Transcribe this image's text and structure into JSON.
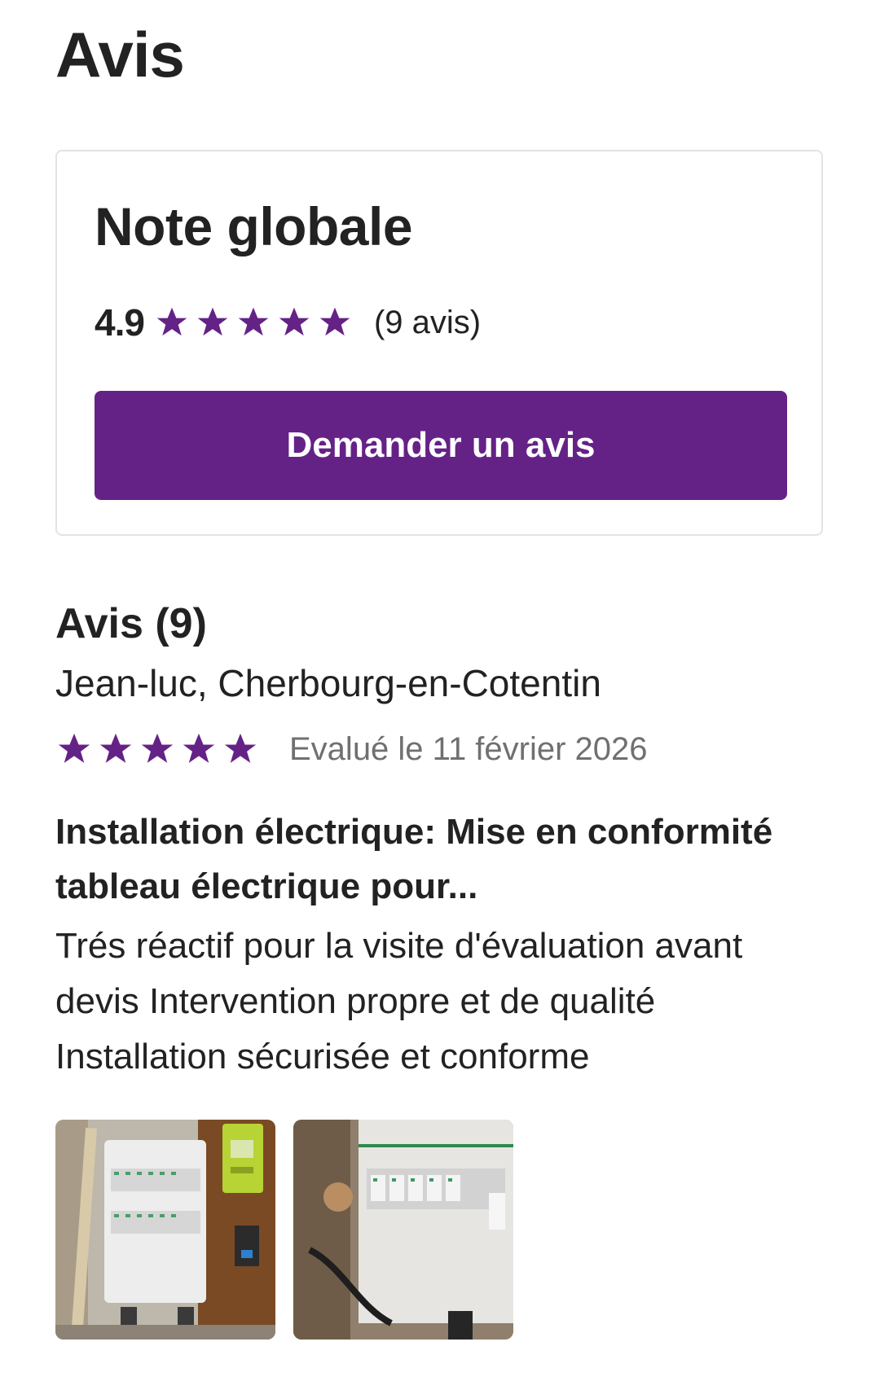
{
  "page": {
    "title": "Avis"
  },
  "summary": {
    "title": "Note globale",
    "rating": "4.9",
    "stars_filled": 5,
    "count_text": "(9 avis)",
    "button_label": "Demander un avis"
  },
  "reviews": {
    "heading": "Avis (9)",
    "items": [
      {
        "author": "Jean-luc, Cherbourg-en-Cotentin",
        "stars_filled": 5,
        "date": "Evalué le 11 février 2026",
        "title": "Installation électrique: Mise en conformité tableau électrique pour...",
        "body": "Trés réactif pour la visite d'évaluation avant devis Intervention propre et de qualité Installation sécurisée et conforme",
        "photos": [
          "electrical-panel-photo",
          "electrical-panel-closeup-photo"
        ]
      }
    ]
  },
  "colors": {
    "accent": "#652286",
    "text": "#222222",
    "muted": "#707070",
    "border": "#e3e3e3"
  }
}
